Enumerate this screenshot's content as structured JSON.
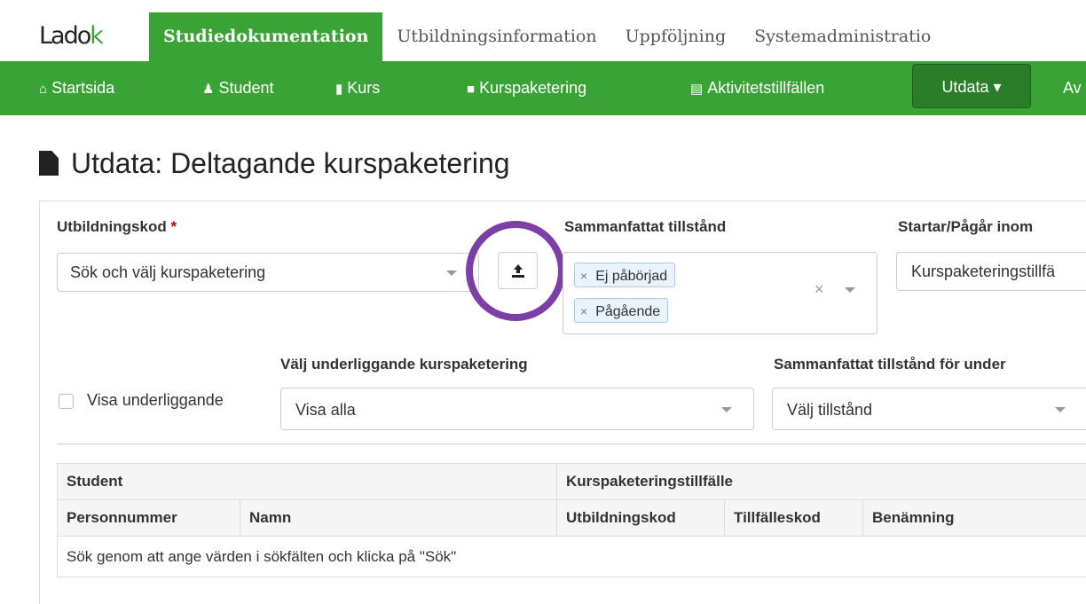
{
  "app": {
    "logo_text": "Ladok",
    "logo_mark": "k"
  },
  "mainnav": [
    {
      "label": "Studiedokumentation",
      "active": true
    },
    {
      "label": "Utbildningsinformation",
      "active": false
    },
    {
      "label": "Uppföljning",
      "active": false
    },
    {
      "label": "Systemadministratio",
      "active": false
    }
  ],
  "subnav": {
    "items": [
      {
        "label": "Startsida",
        "icon": "home-icon"
      },
      {
        "label": "Student",
        "icon": "user-icon"
      },
      {
        "label": "Kurs",
        "icon": "book-icon"
      },
      {
        "label": "Kurspaketering",
        "icon": "folder-icon"
      },
      {
        "label": "Aktivitetstillfällen",
        "icon": "calendar-icon"
      }
    ],
    "dropdown_label": "Utdata",
    "dropdown_caret": "▾",
    "overflow_label": "Av"
  },
  "page": {
    "title": "Utdata: Deltagande kurspaketering"
  },
  "form": {
    "utbildningskod": {
      "label": "Utbildningskod",
      "required_mark": "*",
      "placeholder": "Sök och välj kurspaketering"
    },
    "upload_button_icon": "upload-icon",
    "tillstand": {
      "label": "Sammanfattat tillstånd",
      "tags": [
        "Ej påbörjad",
        "Pågående"
      ],
      "tag_remove": "×",
      "clear": "×"
    },
    "starts": {
      "label": "Startar/Pågår inom",
      "value": "Kurspaketeringstillfä"
    },
    "visa_underliggande": {
      "label": "Visa underliggande",
      "checked": false
    },
    "underliggande": {
      "label": "Välj underliggande kurspaketering",
      "value": "Visa alla"
    },
    "tillstand_under": {
      "label": "Sammanfattat tillstånd för under",
      "placeholder": "Välj tillstånd"
    }
  },
  "table": {
    "group_headers": [
      "Student",
      "Kurspaketeringstillfälle"
    ],
    "columns": [
      "Personnummer",
      "Namn",
      "Utbildningskod",
      "Tillfälleskod",
      "Benämning"
    ],
    "empty_message": "Sök genom att ange värden i sökfälten och klicka på \"Sök\""
  },
  "colors": {
    "brand_green": "#3aa335",
    "dropdown_green": "#2b7d27",
    "highlight_circle": "#7b3fa5"
  }
}
